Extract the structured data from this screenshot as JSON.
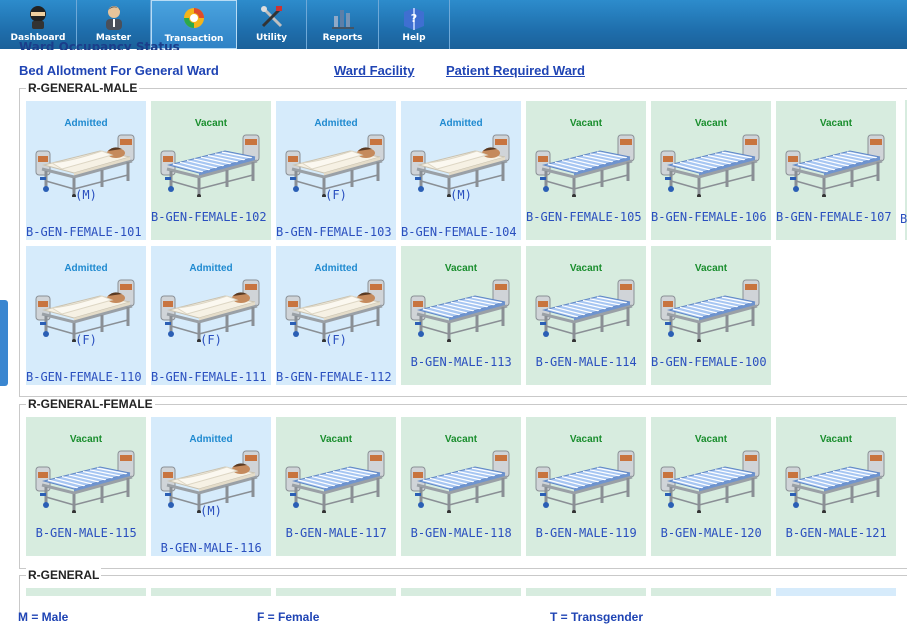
{
  "nav": [
    {
      "label": "Dashboard",
      "icon": "ninja-icon"
    },
    {
      "label": "Master",
      "icon": "person-icon"
    },
    {
      "label": "Transaction",
      "icon": "transaction-icon",
      "active": true
    },
    {
      "label": "Utility",
      "icon": "tools-icon"
    },
    {
      "label": "Reports",
      "icon": "reports-icon"
    },
    {
      "label": "Help",
      "icon": "help-book-icon"
    }
  ],
  "cut_heading": "Ward Occupancy Status",
  "page_title": "Bed Allotment For General Ward",
  "links": {
    "ward_facility": "Ward Facility",
    "patient_required_ward": "Patient Required Ward"
  },
  "sections": [
    {
      "title": "R-GENERAL-MALE"
    },
    {
      "title": "R-GENERAL-FEMALE"
    },
    {
      "title": "R-GENERAL"
    }
  ],
  "beds": [
    {
      "status": "Admitted",
      "gender": "(M)",
      "name": "B-GEN-FEMALE-101"
    },
    {
      "status": "Vacant",
      "gender": "",
      "name": "B-GEN-FEMALE-102"
    },
    {
      "status": "Admitted",
      "gender": "(F)",
      "name": "B-GEN-FEMALE-103"
    },
    {
      "status": "Admitted",
      "gender": "(M)",
      "name": "B-GEN-FEMALE-104"
    },
    {
      "status": "Vacant",
      "gender": "",
      "name": "B-GEN-FEMALE-105"
    },
    {
      "status": "Vacant",
      "gender": "",
      "name": "B-GEN-FEMALE-106"
    },
    {
      "status": "Vacant",
      "gender": "",
      "name": "B-GEN-FEMALE-107"
    },
    {
      "status": "Admitted",
      "gender": "(F)",
      "name": "B-GEN-FEMALE-110"
    },
    {
      "status": "Admitted",
      "gender": "(F)",
      "name": "B-GEN-FEMALE-111"
    },
    {
      "status": "Admitted",
      "gender": "(F)",
      "name": "B-GEN-FEMALE-112"
    },
    {
      "status": "Vacant",
      "gender": "",
      "name": "B-GEN-MALE-113"
    },
    {
      "status": "Vacant",
      "gender": "",
      "name": "B-GEN-MALE-114"
    },
    {
      "status": "Vacant",
      "gender": "",
      "name": "B-GEN-FEMALE-100"
    },
    {
      "status": "Vacant",
      "gender": "",
      "name": "B-GEN-MALE-115"
    },
    {
      "status": "Admitted",
      "gender": "(M)",
      "name": "B-GEN-MALE-116"
    },
    {
      "status": "Vacant",
      "gender": "",
      "name": "B-GEN-MALE-117"
    },
    {
      "status": "Vacant",
      "gender": "",
      "name": "B-GEN-MALE-118"
    },
    {
      "status": "Vacant",
      "gender": "",
      "name": "B-GEN-MALE-119"
    },
    {
      "status": "Vacant",
      "gender": "",
      "name": "B-GEN-MALE-120"
    },
    {
      "status": "Vacant",
      "gender": "",
      "name": "B-GEN-MALE-121"
    }
  ],
  "legend": {
    "male": "M = Male",
    "female": "F = Female",
    "transgender": "T = Transgender"
  }
}
